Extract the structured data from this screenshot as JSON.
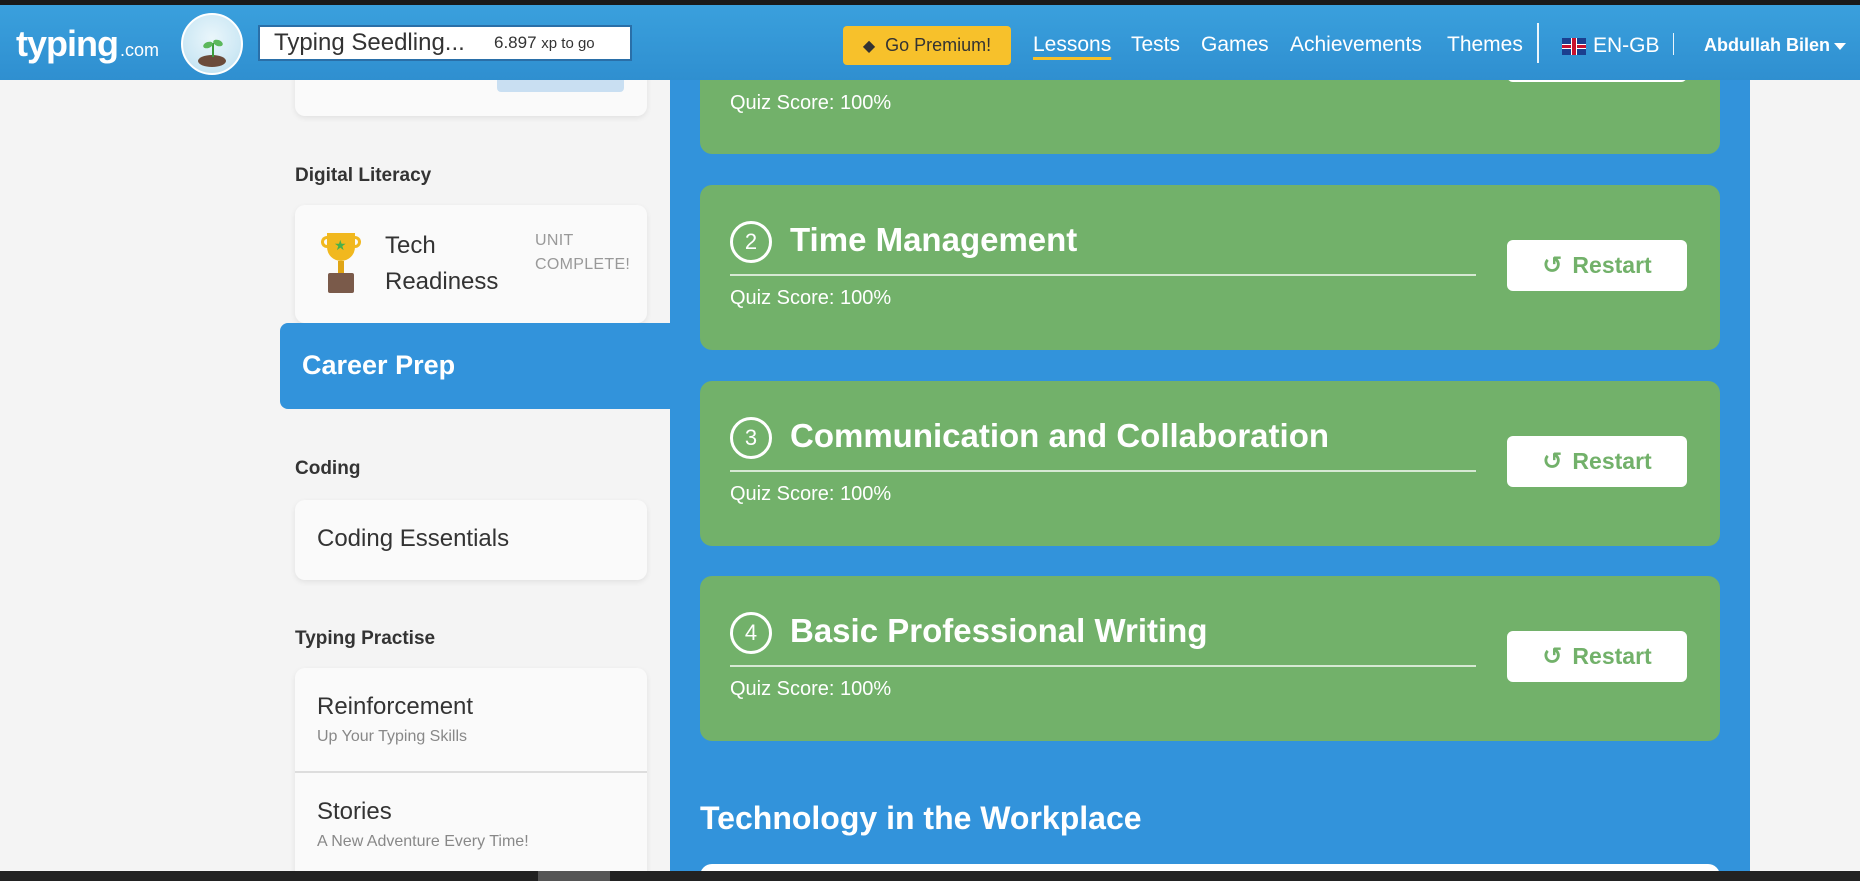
{
  "header": {
    "logo_main": "typing",
    "logo_suffix": ".com",
    "level_name": "Typing Seedling...",
    "xp_value": "6.897",
    "xp_suffix": "xp to go",
    "premium_label": "Go Premium!",
    "nav": {
      "lessons": "Lessons",
      "tests": "Tests",
      "games": "Games",
      "achievements": "Achievements",
      "themes": "Themes"
    },
    "language": "EN-GB",
    "user_name": "Abdullah Bilen"
  },
  "sidebar": {
    "digital_literacy_title": "Digital Literacy",
    "tech_readiness": {
      "title": "Tech Readiness",
      "status": "UNIT COMPLETE!"
    },
    "career_prep": "Career Prep",
    "coding_title": "Coding",
    "coding_essentials": "Coding Essentials",
    "typing_practise_title": "Typing Practise",
    "typing_items": [
      {
        "title": "Reinforcement",
        "subtitle": "Up Your Typing Skills"
      },
      {
        "title": "Stories",
        "subtitle": "A New Adventure Every Time!"
      }
    ]
  },
  "main": {
    "partial_card": {
      "quiz_score": "Quiz Score: 100%"
    },
    "lessons": [
      {
        "number": "2",
        "title": "Time Management",
        "quiz_score": "Quiz Score: 100%",
        "button": "Restart"
      },
      {
        "number": "3",
        "title": "Communication and Collaboration",
        "quiz_score": "Quiz Score: 100%",
        "button": "Restart"
      },
      {
        "number": "4",
        "title": "Basic Professional Writing",
        "quiz_score": "Quiz Score: 100%",
        "button": "Restart"
      }
    ],
    "next_section_title": "Technology in the Workplace"
  },
  "colors": {
    "header_blue": "#2f8fd0",
    "panel_blue": "#3293db",
    "lesson_green": "#72b16a",
    "premium_yellow": "#f7c12b"
  },
  "icons": {
    "premium": "diamond-icon",
    "restart": "history-icon",
    "trophy": "trophy-icon",
    "flag": "uk-flag-icon",
    "caret": "caret-down-icon"
  }
}
